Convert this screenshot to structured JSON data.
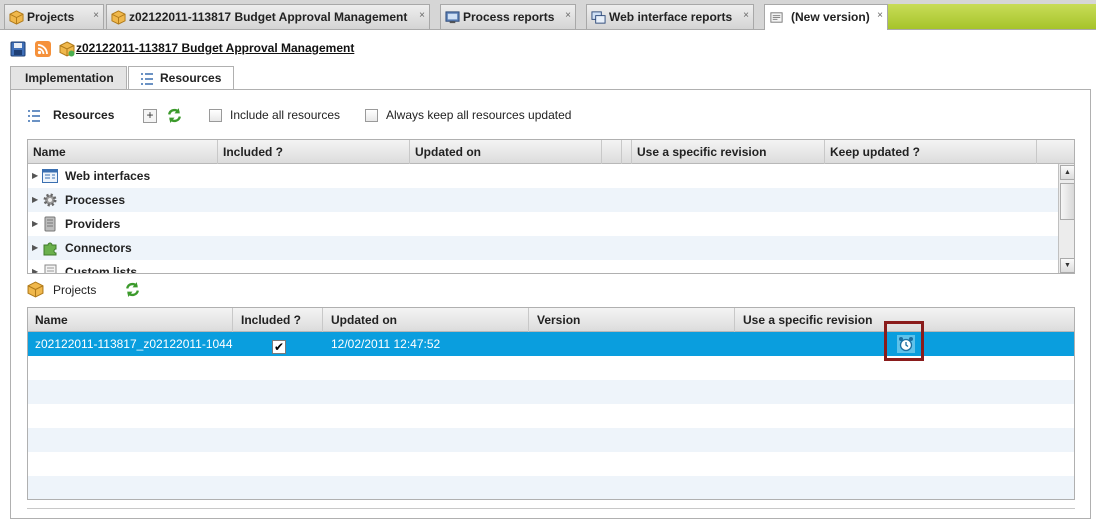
{
  "tabs": [
    {
      "label": "Projects",
      "icon": "package-icon",
      "close": "×"
    },
    {
      "label": "z02122011-113817 Budget Approval Management",
      "icon": "package-icon",
      "close": "×"
    },
    {
      "label": "Process reports",
      "icon": "monitor-icon",
      "close": "×"
    },
    {
      "label": "Web interface reports",
      "icon": "windows-icon",
      "close": "×"
    },
    {
      "label": "(New version)",
      "icon": "document-icon",
      "close": "×"
    }
  ],
  "header": {
    "title": "z02122011-113817 Budget Approval Management",
    "icons": [
      "save-icon",
      "rss-icon",
      "package-icon"
    ]
  },
  "subtabs": {
    "implementation": "Implementation",
    "resources": "Resources"
  },
  "resources_section": {
    "title": "Resources",
    "add_icon": "plus-icon",
    "refresh_icon": "refresh-icon",
    "include_all_label": "Include all resources",
    "keep_updated_label": "Always keep all resources updated",
    "columns": [
      "Name",
      "Included ?",
      "Updated on",
      "",
      "Use a specific revision",
      "Keep updated ?"
    ],
    "items": [
      {
        "label": "Web interfaces",
        "icon": "web-interface-icon"
      },
      {
        "label": "Processes",
        "icon": "gear-icon"
      },
      {
        "label": "Providers",
        "icon": "database-icon"
      },
      {
        "label": "Connectors",
        "icon": "puzzle-icon"
      },
      {
        "label": "Custom lists",
        "icon": "list-icon"
      }
    ]
  },
  "projects_section": {
    "title": "Projects",
    "refresh_icon": "refresh-icon",
    "columns": [
      "Name",
      "Included ?",
      "Updated on",
      "Version",
      "Use a specific revision"
    ],
    "rows": [
      {
        "name": "z02122011-113817_z02122011-1044",
        "included": "✔",
        "updated_on": "12/02/2011 12:47:52",
        "version": "",
        "revision_icon": "alarm-clock-icon"
      }
    ]
  },
  "colors": {
    "selected_row": "#0a9ede",
    "highlight_box": "#8a1c1c",
    "tab_strip_accent": "#b4cc3a"
  }
}
